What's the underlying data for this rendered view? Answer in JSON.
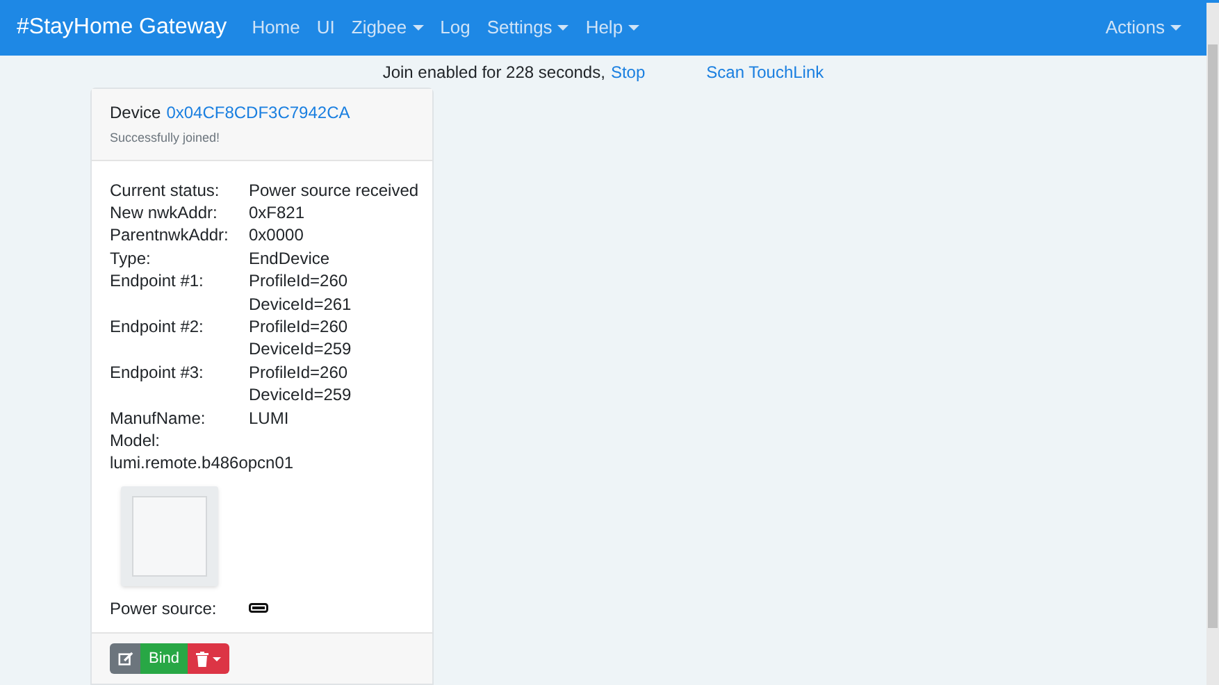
{
  "navbar": {
    "brand": "#StayHome Gateway",
    "items": [
      {
        "label": "Home",
        "dropdown": false
      },
      {
        "label": "UI",
        "dropdown": false
      },
      {
        "label": "Zigbee",
        "dropdown": true
      },
      {
        "label": "Log",
        "dropdown": false
      },
      {
        "label": "Settings",
        "dropdown": true
      },
      {
        "label": "Help",
        "dropdown": true
      }
    ],
    "actions": {
      "label": "Actions",
      "dropdown": true
    }
  },
  "join_bar": {
    "text": "Join enabled for 228 seconds,",
    "stop_link": "Stop",
    "touchlink_link": "Scan TouchLink"
  },
  "device_card": {
    "title": "Device",
    "address": "0x04CF8CDF3C7942CA",
    "subtitle": "Successfully joined!",
    "rows": [
      {
        "kind": "pair",
        "label": "Current status:",
        "values": [
          "Power source received"
        ]
      },
      {
        "kind": "pair",
        "label": "New nwkAddr:",
        "values": [
          "0xF821"
        ]
      },
      {
        "kind": "pair",
        "label": "ParentnwkAddr:",
        "values": [
          "0x0000"
        ]
      },
      {
        "kind": "pair",
        "label": "Type:",
        "values": [
          "EndDevice"
        ]
      },
      {
        "kind": "pair",
        "label": "Endpoint #1:",
        "values": [
          "ProfileId=260",
          "DeviceId=261"
        ]
      },
      {
        "kind": "pair",
        "label": "Endpoint #2:",
        "values": [
          "ProfileId=260",
          "DeviceId=259"
        ]
      },
      {
        "kind": "pair",
        "label": "Endpoint #3:",
        "values": [
          "ProfileId=260",
          "DeviceId=259"
        ]
      },
      {
        "kind": "pair",
        "label": "ManufName:",
        "values": [
          "LUMI"
        ]
      },
      {
        "kind": "stacked",
        "label": "Model:",
        "values": [
          "lumi.remote.b486opcn01"
        ]
      }
    ],
    "power_source_label": "Power source:",
    "footer": {
      "bind_label": "Bind"
    }
  }
}
